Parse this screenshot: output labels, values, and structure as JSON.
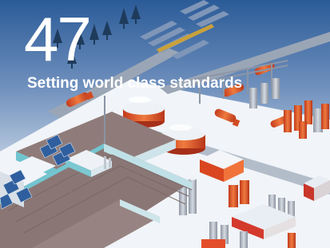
{
  "page": {
    "number": "47",
    "headline": "Setting world class standards"
  },
  "illustration": {
    "subject": "isometric industrial plant with tanker trucks, storage tanks, warehouses with solar panels",
    "colors": {
      "sky_top": "#2b5b98",
      "sky_bottom": "#dfe8f2",
      "accent": "#e2572a",
      "roof": "#8c7b79",
      "ground": "#f2f5f9"
    }
  }
}
